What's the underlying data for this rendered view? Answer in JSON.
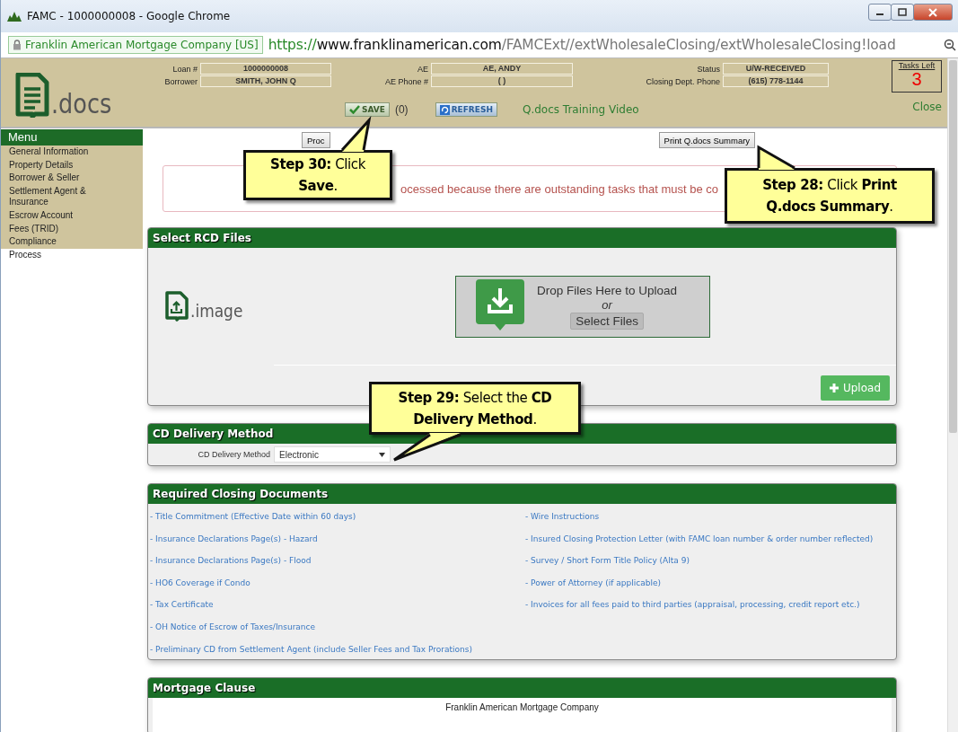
{
  "window": {
    "title": "FAMC - 1000000008 - Google Chrome"
  },
  "address_bar": {
    "site_identity": "Franklin American Mortgage Company [US]",
    "url_scheme": "https://",
    "url_host": "www.franklinamerican.com",
    "url_path": "/FAMCExt//extWholesaleClosing/extWholesaleClosing!load"
  },
  "header": {
    "logo_text": ".docs",
    "field_columns": [
      [
        {
          "label": "Loan #",
          "value": "1000000008"
        },
        {
          "label": "Borrower",
          "value": "SMITH, JOHN Q"
        }
      ],
      [
        {
          "label": "AE",
          "value": "AE,  ANDY"
        },
        {
          "label": "AE Phone #",
          "value": "( )"
        }
      ],
      [
        {
          "label": "Status",
          "value": "U/W-RECEIVED"
        },
        {
          "label": "Closing Dept. Phone",
          "value": "(615) 778-1144"
        }
      ]
    ],
    "tasks_left": {
      "label": "Tasks Left",
      "count": "3"
    },
    "save_button": "SAVE",
    "save_count": "(0)",
    "refresh_button": "REFRESH",
    "training_video_link": "Q.docs Training Video",
    "close_link": "Close"
  },
  "menu": {
    "title": "Menu",
    "items": [
      {
        "label": "General Information",
        "selected": false
      },
      {
        "label": "Property Details",
        "selected": false
      },
      {
        "label": "Borrower & Seller",
        "selected": false
      },
      {
        "label": "Settlement Agent & Insurance",
        "selected": false
      },
      {
        "label": "Escrow Account",
        "selected": false
      },
      {
        "label": "Fees (TRID)",
        "selected": false
      },
      {
        "label": "Compliance",
        "selected": false
      },
      {
        "label": "Process",
        "selected": true
      }
    ]
  },
  "actions": {
    "process_button": "Proc",
    "print_button": "Print Q.docs Summary"
  },
  "error_message": "ocessed because there are outstanding tasks that must be co",
  "select_rcd_files": {
    "title": "Select RCD Files",
    "logo_text": ".image",
    "drop_text": "Drop Files Here to Upload",
    "or_text": "or",
    "select_button": "Select Files",
    "upload_button": "Upload"
  },
  "cd_delivery": {
    "title": "CD Delivery Method",
    "label": "CD Delivery Method",
    "value": "Electronic"
  },
  "required_docs": {
    "title": "Required Closing Documents",
    "left": [
      "- Title Commitment (Effective Date within 60 days)",
      "- Insurance Declarations Page(s) - Hazard",
      "- Insurance Declarations Page(s) - Flood",
      "- HO6 Coverage if Condo",
      "- Tax Certificate",
      "- OH Notice of Escrow of Taxes/Insurance",
      "- Preliminary CD from Settlement Agent (include Seller Fees and Tax Prorations)"
    ],
    "right": [
      "- Wire Instructions",
      "- Insured Closing Protection Letter (with FAMC loan number & order number reflected)",
      "- Survey / Short Form Title Policy (Alta 9)",
      "- Power of Attorney (if applicable)",
      "- Invoices for all fees paid to third parties (appraisal, processing, credit report etc.)"
    ]
  },
  "mortgage_clause": {
    "title": "Mortgage Clause",
    "lines": [
      "Franklin American Mortgage Company"
    ]
  },
  "callouts": [
    {
      "text": "**Step 30:** Click **Save**."
    },
    {
      "text": "**Step 28:** Click **Print Q.docs Summary**."
    },
    {
      "text": "**Step 29:** Select the **CD Delivery Method**."
    }
  ]
}
